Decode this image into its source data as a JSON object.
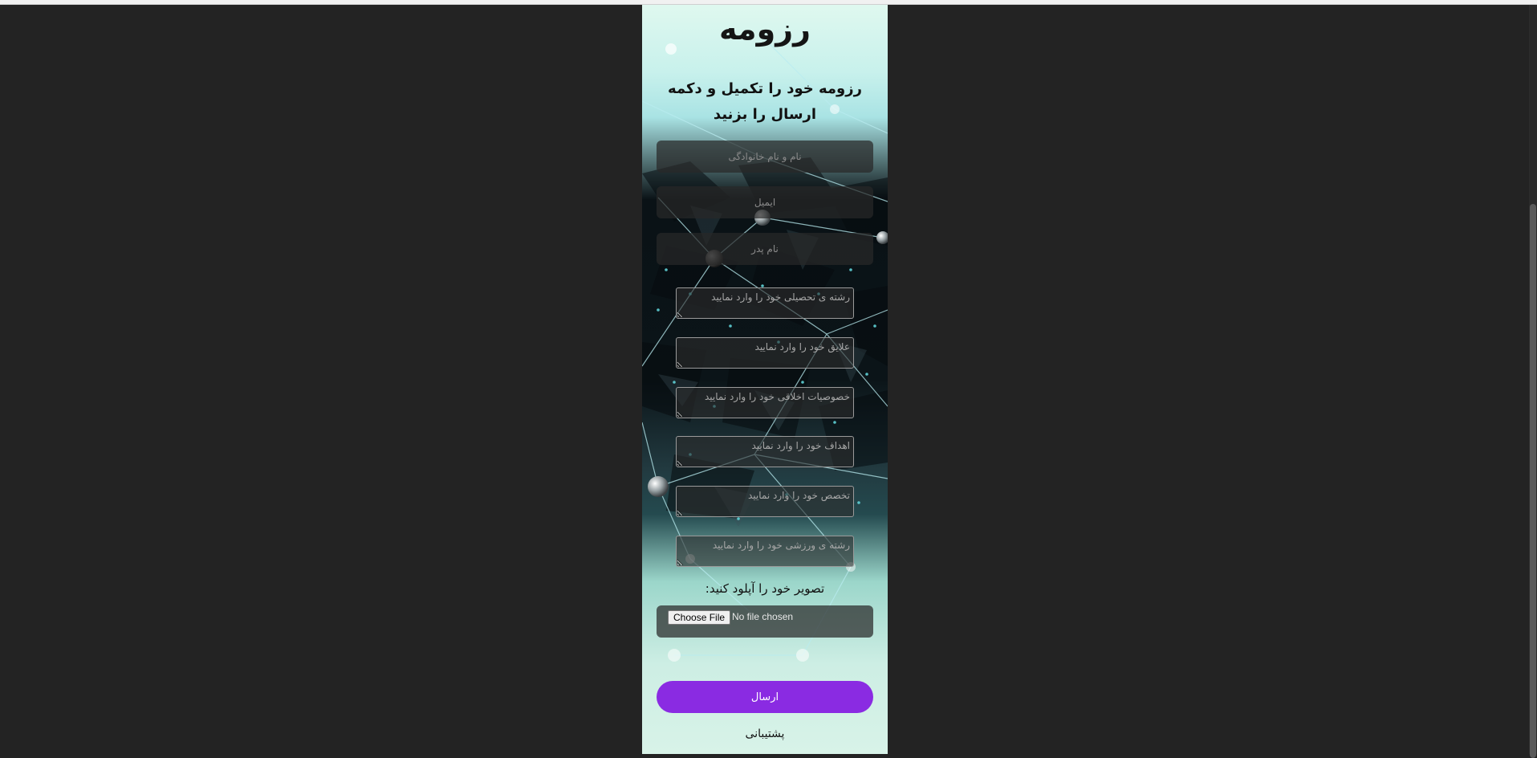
{
  "page": {
    "title": "رزومه",
    "subtitle": "رزومه خود را تکمیل و دکمه ارسال را بزنید"
  },
  "form": {
    "inputs": [
      {
        "placeholder": "نام و نام خانوادگی"
      },
      {
        "placeholder": "ایمیل"
      },
      {
        "placeholder": "نام پدر"
      }
    ],
    "textareas": [
      {
        "placeholder": "رشته ی تحصیلی خود را وارد نمایید"
      },
      {
        "placeholder": "علایق خود را وارد نمایید"
      },
      {
        "placeholder": "خصوصیات اخلاقی خود را وارد نمایید"
      },
      {
        "placeholder": "اهداف خود را وارد نمایید"
      },
      {
        "placeholder": "تخصص خود را وارد نمایید"
      },
      {
        "placeholder": "رشته ی ورزشی خود را وارد نمایید"
      }
    ],
    "upload_label": "تصویر خود را آپلود کنید:",
    "file_button": "Choose File",
    "file_status": "No file chosen",
    "submit_label": "ارسال",
    "support_link": "پشتیبانی"
  },
  "colors": {
    "page_background": "#232323",
    "accent": "#8a2be2"
  }
}
